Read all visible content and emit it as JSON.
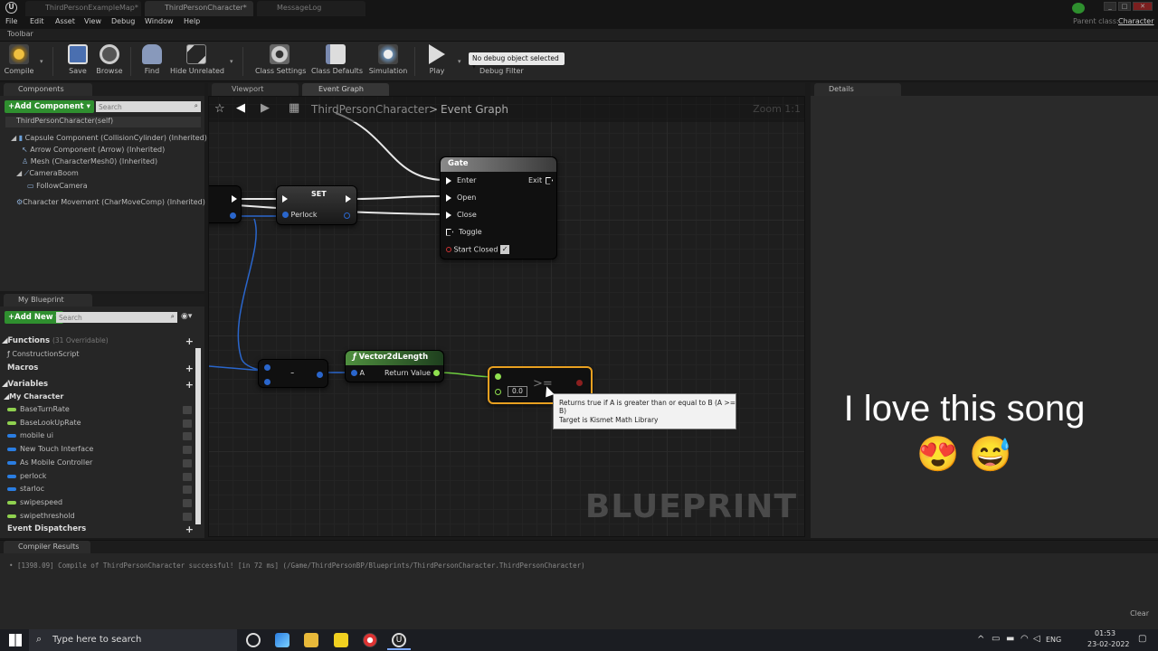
{
  "tabs": [
    {
      "label": "ThirdPersonExampleMap*"
    },
    {
      "label": "ThirdPersonCharacter*"
    },
    {
      "label": "MessageLog"
    }
  ],
  "parent_class": {
    "label": "Parent class:",
    "value": "Character"
  },
  "menu": [
    "File",
    "Edit",
    "Asset",
    "View",
    "Debug",
    "Window",
    "Help"
  ],
  "toolbar": {
    "title": "Toolbar",
    "buttons": [
      {
        "label": "Compile",
        "icon": "compile-icon"
      },
      {
        "label": "Save",
        "icon": "save-icon"
      },
      {
        "label": "Browse",
        "icon": "browse-icon"
      },
      {
        "label": "Find",
        "icon": "binoculars-icon"
      },
      {
        "label": "Hide Unrelated",
        "icon": "hide-unrelated-icon"
      },
      {
        "label": "Class Settings",
        "icon": "gear-icon"
      },
      {
        "label": "Class Defaults",
        "icon": "class-defaults-icon"
      },
      {
        "label": "Simulation",
        "icon": "simulation-icon"
      },
      {
        "label": "Play",
        "icon": "play-icon"
      }
    ],
    "debug_select": "No debug object selected",
    "debug_label": "Debug Filter"
  },
  "components": {
    "title": "Components",
    "add_label": "+Add Component",
    "search_placeholder": "Search",
    "root": "ThirdPersonCharacter(self)",
    "items": [
      "Capsule Component (CollisionCylinder) (Inherited)",
      "Arrow Component (Arrow) (Inherited)",
      "Mesh (CharacterMesh0) (Inherited)",
      "CameraBoom",
      "FollowCamera",
      "Character Movement (CharMoveComp) (Inherited)"
    ]
  },
  "my_blueprint": {
    "title": "My Blueprint",
    "add_label": "+Add New",
    "search_placeholder": "Search",
    "functions_label": "Functions",
    "functions_count": "(31 Overridable)",
    "functions": [
      "ConstructionScript"
    ],
    "macros_label": "Macros",
    "variables_label": "Variables",
    "category": "My Character",
    "variables": [
      {
        "name": "BaseTurnRate",
        "color": "#8fd14f"
      },
      {
        "name": "BaseLookUpRate",
        "color": "#8fd14f"
      },
      {
        "name": "mobile ui",
        "color": "#2a7de1"
      },
      {
        "name": "New Touch Interface",
        "color": "#2a7de1"
      },
      {
        "name": "As Mobile Controller",
        "color": "#2a7de1"
      },
      {
        "name": "perlock",
        "color": "#2a7de1"
      },
      {
        "name": "starloc",
        "color": "#2a7de1"
      },
      {
        "name": "swipespeed",
        "color": "#8fd14f"
      },
      {
        "name": "swipethreshold",
        "color": "#8fd14f"
      }
    ],
    "dispatchers_label": "Event Dispatchers"
  },
  "graph": {
    "tabs": [
      "Viewport",
      "Event Graph"
    ],
    "breadcrumb_root": "ThirdPersonCharacter",
    "breadcrumb_sep": ">",
    "breadcrumb_leaf": "Event Graph",
    "zoom": "Zoom 1:1",
    "watermark": "BLUEPRINT",
    "gate": {
      "title": "Gate",
      "enter": "Enter",
      "exit": "Exit",
      "open": "Open",
      "close": "Close",
      "toggle": "Toggle",
      "start_closed": "Start Closed"
    },
    "set": {
      "title": "SET",
      "var": "Perlock"
    },
    "minus": "-",
    "vec": {
      "title": "Vector2dLength",
      "input": "A",
      "output": "Return Value"
    },
    "compare": {
      "symbol": ">=",
      "value": "0.0"
    },
    "tooltip": {
      "line1": "Returns true if A is greater than or equal to B (A >= B)",
      "line2": "Target is Kismet Math Library"
    }
  },
  "details": {
    "title": "Details"
  },
  "overlay": {
    "text": "I love this song",
    "emoji": "😍 😅"
  },
  "compiler": {
    "title": "Compiler Results",
    "log": "• [1398.09] Compile of ThirdPersonCharacter successful! [in 72 ms] (/Game/ThirdPersonBP/Blueprints/ThirdPersonCharacter.ThirdPersonCharacter)",
    "clear": "Clear"
  },
  "taskbar": {
    "search_placeholder": "Type here to search",
    "lang": "ENG",
    "time": "01:53",
    "date": "23-02-2022"
  }
}
